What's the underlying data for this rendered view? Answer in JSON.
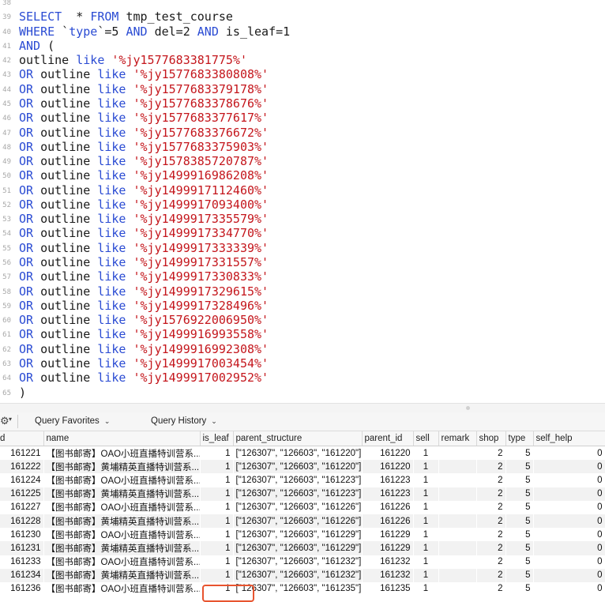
{
  "editor": {
    "lines": [
      {
        "n": "38",
        "parts": []
      },
      {
        "n": "39",
        "parts": [
          [
            "kw",
            "SELECT"
          ],
          [
            "",
            "  * "
          ],
          [
            "kw",
            "FROM"
          ],
          [
            "",
            " tmp_test_course"
          ]
        ]
      },
      {
        "n": "40",
        "parts": [
          [
            "kw",
            "WHERE"
          ],
          [
            "",
            " `"
          ],
          [
            "kw",
            "type"
          ],
          [
            "",
            "`=5 "
          ],
          [
            "kw",
            "AND"
          ],
          [
            "",
            " del=2 "
          ],
          [
            "kw",
            "AND"
          ],
          [
            "",
            " is_leaf=1"
          ]
        ]
      },
      {
        "n": "41",
        "parts": [
          [
            "kw",
            "AND"
          ],
          [
            "",
            " ("
          ]
        ]
      },
      {
        "n": "42",
        "parts": [
          [
            "",
            "outline "
          ],
          [
            "kw",
            "like"
          ],
          [
            "",
            " "
          ],
          [
            "str",
            "'%jy1577683381775%'"
          ]
        ]
      },
      {
        "n": "43",
        "parts": [
          [
            "kw",
            "OR"
          ],
          [
            "",
            " outline "
          ],
          [
            "kw",
            "like"
          ],
          [
            "",
            " "
          ],
          [
            "str",
            "'%jy1577683380808%'"
          ]
        ]
      },
      {
        "n": "44",
        "parts": [
          [
            "kw",
            "OR"
          ],
          [
            "",
            " outline "
          ],
          [
            "kw",
            "like"
          ],
          [
            "",
            " "
          ],
          [
            "str",
            "'%jy1577683379178%'"
          ]
        ]
      },
      {
        "n": "45",
        "parts": [
          [
            "kw",
            "OR"
          ],
          [
            "",
            " outline "
          ],
          [
            "kw",
            "like"
          ],
          [
            "",
            " "
          ],
          [
            "str",
            "'%jy1577683378676%'"
          ]
        ]
      },
      {
        "n": "46",
        "parts": [
          [
            "kw",
            "OR"
          ],
          [
            "",
            " outline "
          ],
          [
            "kw",
            "like"
          ],
          [
            "",
            " "
          ],
          [
            "str",
            "'%jy1577683377617%'"
          ]
        ]
      },
      {
        "n": "47",
        "parts": [
          [
            "kw",
            "OR"
          ],
          [
            "",
            " outline "
          ],
          [
            "kw",
            "like"
          ],
          [
            "",
            " "
          ],
          [
            "str",
            "'%jy1577683376672%'"
          ]
        ]
      },
      {
        "n": "48",
        "parts": [
          [
            "kw",
            "OR"
          ],
          [
            "",
            " outline "
          ],
          [
            "kw",
            "like"
          ],
          [
            "",
            " "
          ],
          [
            "str",
            "'%jy1577683375903%'"
          ]
        ]
      },
      {
        "n": "49",
        "parts": [
          [
            "kw",
            "OR"
          ],
          [
            "",
            " outline "
          ],
          [
            "kw",
            "like"
          ],
          [
            "",
            " "
          ],
          [
            "str",
            "'%jy1578385720787%'"
          ]
        ]
      },
      {
        "n": "50",
        "parts": [
          [
            "kw",
            "OR"
          ],
          [
            "",
            " outline "
          ],
          [
            "kw",
            "like"
          ],
          [
            "",
            " "
          ],
          [
            "str",
            "'%jy1499916986208%'"
          ]
        ]
      },
      {
        "n": "51",
        "parts": [
          [
            "kw",
            "OR"
          ],
          [
            "",
            " outline "
          ],
          [
            "kw",
            "like"
          ],
          [
            "",
            " "
          ],
          [
            "str",
            "'%jy1499917112460%'"
          ]
        ]
      },
      {
        "n": "52",
        "parts": [
          [
            "kw",
            "OR"
          ],
          [
            "",
            " outline "
          ],
          [
            "kw",
            "like"
          ],
          [
            "",
            " "
          ],
          [
            "str",
            "'%jy1499917093400%'"
          ]
        ]
      },
      {
        "n": "53",
        "parts": [
          [
            "kw",
            "OR"
          ],
          [
            "",
            " outline "
          ],
          [
            "kw",
            "like"
          ],
          [
            "",
            " "
          ],
          [
            "str",
            "'%jy1499917335579%'"
          ]
        ]
      },
      {
        "n": "54",
        "parts": [
          [
            "kw",
            "OR"
          ],
          [
            "",
            " outline "
          ],
          [
            "kw",
            "like"
          ],
          [
            "",
            " "
          ],
          [
            "str",
            "'%jy1499917334770%'"
          ]
        ]
      },
      {
        "n": "55",
        "parts": [
          [
            "kw",
            "OR"
          ],
          [
            "",
            " outline "
          ],
          [
            "kw",
            "like"
          ],
          [
            "",
            " "
          ],
          [
            "str",
            "'%jy1499917333339%'"
          ]
        ]
      },
      {
        "n": "56",
        "parts": [
          [
            "kw",
            "OR"
          ],
          [
            "",
            " outline "
          ],
          [
            "kw",
            "like"
          ],
          [
            "",
            " "
          ],
          [
            "str",
            "'%jy1499917331557%'"
          ]
        ]
      },
      {
        "n": "57",
        "parts": [
          [
            "kw",
            "OR"
          ],
          [
            "",
            " outline "
          ],
          [
            "kw",
            "like"
          ],
          [
            "",
            " "
          ],
          [
            "str",
            "'%jy1499917330833%'"
          ]
        ]
      },
      {
        "n": "58",
        "parts": [
          [
            "kw",
            "OR"
          ],
          [
            "",
            " outline "
          ],
          [
            "kw",
            "like"
          ],
          [
            "",
            " "
          ],
          [
            "str",
            "'%jy1499917329615%'"
          ]
        ]
      },
      {
        "n": "59",
        "parts": [
          [
            "kw",
            "OR"
          ],
          [
            "",
            " outline "
          ],
          [
            "kw",
            "like"
          ],
          [
            "",
            " "
          ],
          [
            "str",
            "'%jy1499917328496%'"
          ]
        ]
      },
      {
        "n": "60",
        "parts": [
          [
            "kw",
            "OR"
          ],
          [
            "",
            " outline "
          ],
          [
            "kw",
            "like"
          ],
          [
            "",
            " "
          ],
          [
            "str",
            "'%jy1576922006950%'"
          ]
        ]
      },
      {
        "n": "61",
        "parts": [
          [
            "kw",
            "OR"
          ],
          [
            "",
            " outline "
          ],
          [
            "kw",
            "like"
          ],
          [
            "",
            " "
          ],
          [
            "str",
            "'%jy1499916993558%'"
          ]
        ]
      },
      {
        "n": "62",
        "parts": [
          [
            "kw",
            "OR"
          ],
          [
            "",
            " outline "
          ],
          [
            "kw",
            "like"
          ],
          [
            "",
            " "
          ],
          [
            "str",
            "'%jy1499916992308%'"
          ]
        ]
      },
      {
        "n": "63",
        "parts": [
          [
            "kw",
            "OR"
          ],
          [
            "",
            " outline "
          ],
          [
            "kw",
            "like"
          ],
          [
            "",
            " "
          ],
          [
            "str",
            "'%jy1499917003454%'"
          ]
        ]
      },
      {
        "n": "64",
        "parts": [
          [
            "kw",
            "OR"
          ],
          [
            "",
            " outline "
          ],
          [
            "kw",
            "like"
          ],
          [
            "",
            " "
          ],
          [
            "str",
            "'%jy1499917002952%'"
          ]
        ]
      },
      {
        "n": "65",
        "parts": [
          [
            "",
            ")"
          ]
        ]
      }
    ]
  },
  "toolbar": {
    "gear_icon": "gear-icon",
    "favorites_label": "Query Favorites",
    "history_label": "Query History",
    "caret": "⌄"
  },
  "results": {
    "columns": [
      "d",
      "name",
      "is_leaf",
      "parent_structure",
      "parent_id",
      "sell",
      "remark",
      "shop",
      "type",
      "self_help"
    ],
    "rows": [
      [
        "161221",
        "【图书邮寄】OAO小班直播特训营系...",
        "1",
        "[\"126307\", \"126603\", \"161220\"]",
        "161220",
        "1",
        "",
        "2",
        "5",
        "0"
      ],
      [
        "161222",
        "【图书邮寄】黄埔精英直播特训营系...",
        "1",
        "[\"126307\", \"126603\", \"161220\"]",
        "161220",
        "1",
        "",
        "2",
        "5",
        "0"
      ],
      [
        "161224",
        "【图书邮寄】OAO小班直播特训营系...",
        "1",
        "[\"126307\", \"126603\", \"161223\"]",
        "161223",
        "1",
        "",
        "2",
        "5",
        "0"
      ],
      [
        "161225",
        "【图书邮寄】黄埔精英直播特训营系...",
        "1",
        "[\"126307\", \"126603\", \"161223\"]",
        "161223",
        "1",
        "",
        "2",
        "5",
        "0"
      ],
      [
        "161227",
        "【图书邮寄】OAO小班直播特训营系...",
        "1",
        "[\"126307\", \"126603\", \"161226\"]",
        "161226",
        "1",
        "",
        "2",
        "5",
        "0"
      ],
      [
        "161228",
        "【图书邮寄】黄埔精英直播特训营系...",
        "1",
        "[\"126307\", \"126603\", \"161226\"]",
        "161226",
        "1",
        "",
        "2",
        "5",
        "0"
      ],
      [
        "161230",
        "【图书邮寄】OAO小班直播特训营系...",
        "1",
        "[\"126307\", \"126603\", \"161229\"]",
        "161229",
        "1",
        "",
        "2",
        "5",
        "0"
      ],
      [
        "161231",
        "【图书邮寄】黄埔精英直播特训营系...",
        "1",
        "[\"126307\", \"126603\", \"161229\"]",
        "161229",
        "1",
        "",
        "2",
        "5",
        "0"
      ],
      [
        "161233",
        "【图书邮寄】OAO小班直播特训营系...",
        "1",
        "[\"126307\", \"126603\", \"161232\"]",
        "161232",
        "1",
        "",
        "2",
        "5",
        "0"
      ],
      [
        "161234",
        "【图书邮寄】黄埔精英直播特训营系...",
        "1",
        "[\"126307\", \"126603\", \"161232\"]",
        "161232",
        "1",
        "",
        "2",
        "5",
        "0"
      ],
      [
        "161236",
        "【图书邮寄】OAO小班直播特训营系...",
        "1",
        "[\"126307\", \"126603\", \"161235\"]",
        "161235",
        "1",
        "",
        "2",
        "5",
        "0"
      ]
    ]
  },
  "colors": {
    "keyword": "#2a4bd3",
    "string": "#c4161c",
    "highlight": "#e8542f"
  }
}
